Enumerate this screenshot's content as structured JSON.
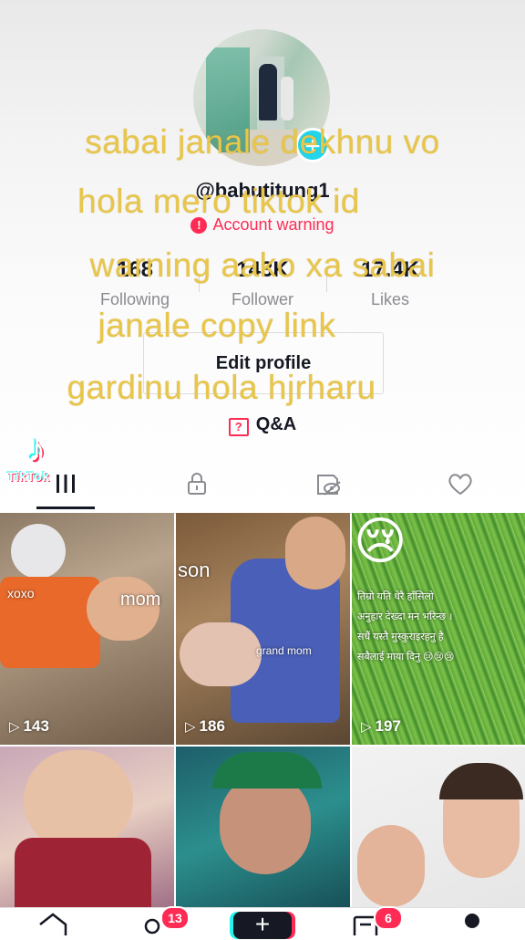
{
  "profile": {
    "username": "@babutitung1",
    "account_warning": "Account warning",
    "edit_profile_label": "Edit profile",
    "qa_label": "Q&A"
  },
  "stats": [
    {
      "value": "168",
      "label": "Following"
    },
    {
      "value": "143K",
      "label": "Follower"
    },
    {
      "value": "17.4K",
      "label": "Likes"
    }
  ],
  "overlay_text": [
    "sabai janale dekhnu vo",
    "hola mero tiktok id",
    "warning aako xa sabai",
    "janale copy link",
    "gardinu hola hjrharu"
  ],
  "watermark": {
    "text": "TikTok"
  },
  "tabs": [
    {
      "name": "videos",
      "icon": "grid-icon"
    },
    {
      "name": "private",
      "icon": "lock-icon"
    },
    {
      "name": "hidden",
      "icon": "eye-off-icon"
    },
    {
      "name": "liked",
      "icon": "heart-icon"
    }
  ],
  "videos": [
    {
      "views": "143",
      "captions": [
        "xoxo",
        "mom"
      ]
    },
    {
      "views": "186",
      "captions": [
        "son",
        "grand mom"
      ]
    },
    {
      "views": "197",
      "captions": [
        "😢",
        "तिम्रो यति धेरै हाँसिलो",
        "अनुहार देख्दा मन भरिन्छ ।",
        "सधैं यस्तै मुस्कुराइरहनु है",
        "सबैलाई माया दिनु 😢😢😢"
      ]
    },
    {
      "views": "",
      "captions": []
    },
    {
      "views": "",
      "captions": []
    },
    {
      "views": "",
      "captions": []
    }
  ],
  "navbar": {
    "inbox_badge": "13",
    "notifications_badge": "6"
  },
  "colors": {
    "accent": "#fe2c55",
    "cyan": "#20d5ec",
    "overlay_text": "#e8c64a"
  }
}
